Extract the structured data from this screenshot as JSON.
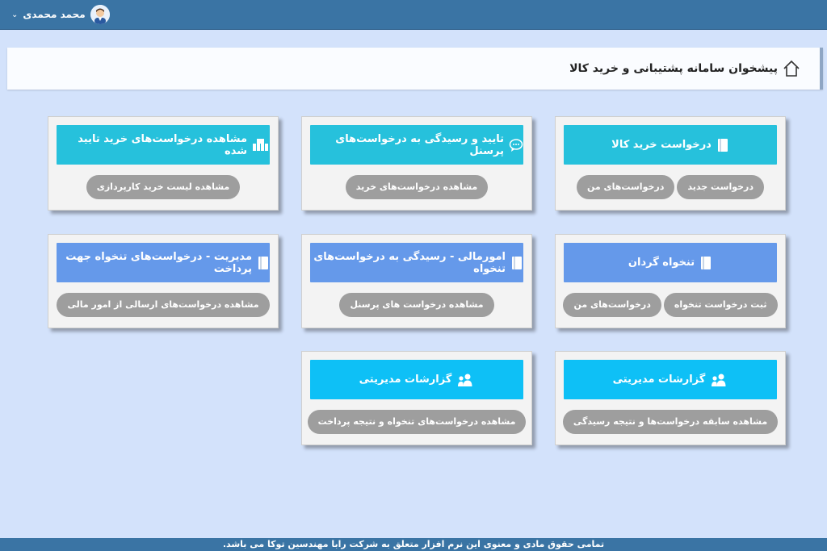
{
  "header": {
    "user_name": "محمد محمدی",
    "chevron_icon": "chevron-down-icon",
    "avatar_icon": "avatar"
  },
  "page": {
    "title": "پیشخوان سامانه پشتیبانی و خرید کالا",
    "title_icon": "home-icon"
  },
  "colors": {
    "teal": "#26c1dc",
    "blue": "#6599ea",
    "cyan": "#0ec0f6",
    "button": "#9e9e9e",
    "topbar": "#3a74a4"
  },
  "cards": [
    {
      "title": "درخواست خرید کالا",
      "icon": "book-icon",
      "buttons": [
        "درخواست جدید",
        "درخواست‌های من"
      ]
    },
    {
      "title": "تایید و رسیدگی به درخواست‌های پرسنل",
      "icon": "chat-icon",
      "buttons": [
        "مشاهده درخواست‌های خرید"
      ]
    },
    {
      "title": "مشاهده درخواست‌های خرید تایید شده",
      "icon": "boxes-icon",
      "buttons": [
        "مشاهده لیست خرید کارپردازی"
      ]
    },
    {
      "title": "تنخواه گردان",
      "icon": "book-icon",
      "buttons": [
        "ثبت درخواست تنخواه",
        "درخواست‌های من"
      ]
    },
    {
      "title": "امورمالی - رسیدگی به درخواست‌های تنخواه",
      "icon": "book-icon",
      "buttons": [
        "مشاهده درخواست های پرسنل"
      ]
    },
    {
      "title": "مدیریت - درخواست‌های تنخواه جهت پرداخت",
      "icon": "book-icon",
      "buttons": [
        "مشاهده درخواست‌های ارسالی از امور مالی"
      ]
    },
    {
      "title": "گزارشات مدیریتی",
      "icon": "users-icon",
      "buttons": [
        "مشاهده سابقه درخواست‌ها و نتیجه رسیدگی"
      ]
    },
    {
      "title": "گزارشات مدیریتی",
      "icon": "users-icon",
      "buttons": [
        "مشاهده درخواست‌های تنخواه و نتیجه پرداخت"
      ]
    }
  ],
  "footer": {
    "text": "تمامی حقوق مادی و معنوی این نرم افزار متعلق به شرکت رابا مهندسین توکا می باشد."
  }
}
